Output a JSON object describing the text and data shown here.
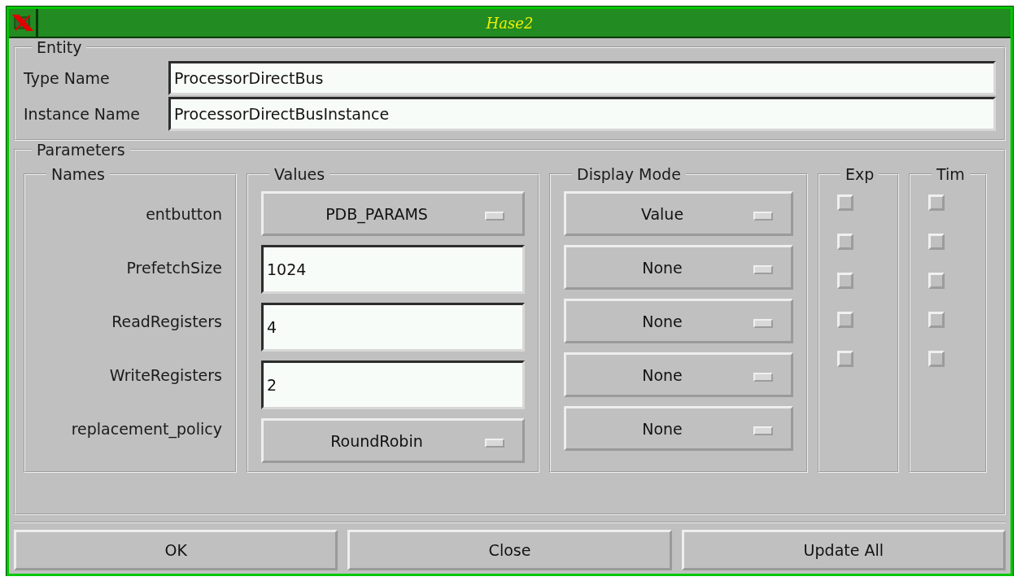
{
  "window": {
    "title": "Hase2"
  },
  "entity": {
    "title": "Entity",
    "fields": [
      {
        "label": "Type Name",
        "value": "ProcessorDirectBus"
      },
      {
        "label": "Instance Name",
        "value": "ProcessorDirectBusInstance"
      }
    ]
  },
  "parameters": {
    "title": "Parameters",
    "names_title": "Names",
    "values_title": "Values",
    "display_title": "Display Mode",
    "exp_title": "Exp",
    "tim_title": "Tim",
    "rows": [
      {
        "name": "entbutton",
        "kind": "menu",
        "value": "PDB_PARAMS",
        "display_mode": "Value"
      },
      {
        "name": "PrefetchSize",
        "kind": "entry",
        "value": "1024",
        "display_mode": "None"
      },
      {
        "name": "ReadRegisters",
        "kind": "entry",
        "value": "4",
        "display_mode": "None"
      },
      {
        "name": "WriteRegisters",
        "kind": "entry",
        "value": "2",
        "display_mode": "None"
      },
      {
        "name": "replacement_policy",
        "kind": "menu",
        "value": "RoundRobin",
        "display_mode": "None"
      }
    ],
    "exp": [
      {
        "checked": false
      },
      {
        "checked": false
      },
      {
        "checked": false
      },
      {
        "checked": false
      },
      {
        "checked": false
      }
    ],
    "tim": [
      {
        "checked": false
      },
      {
        "checked": false
      },
      {
        "checked": false
      },
      {
        "checked": false
      },
      {
        "checked": false
      }
    ]
  },
  "buttons": [
    "OK",
    "Close",
    "Update All"
  ]
}
